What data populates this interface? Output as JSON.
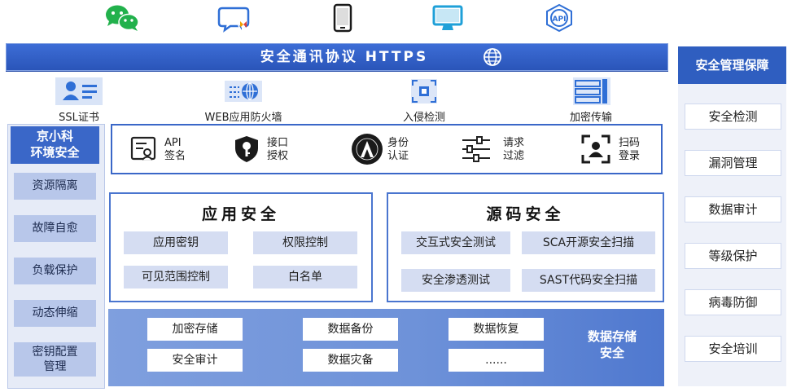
{
  "top_icons": [
    "wechat-icon",
    "chat-icon",
    "mobile-phone-icon",
    "monitor-icon",
    "api-icon"
  ],
  "https_bar": {
    "title": "安全通讯协议 HTTPS",
    "icon": "globe-icon"
  },
  "security_items": [
    {
      "label": "SSL证书",
      "icon": "ssl-certificate-icon"
    },
    {
      "label": "WEB应用防火墙",
      "icon": "web-firewall-icon"
    },
    {
      "label": "入侵检测",
      "icon": "intrusion-detection-icon"
    },
    {
      "label": "加密传输",
      "icon": "encrypted-transfer-icon"
    }
  ],
  "left_column": {
    "title_line1": "京小科",
    "title_line2": "环境安全",
    "items": [
      "资源隔离",
      "故障自愈",
      "负载保护",
      "动态伸缩",
      "密钥配置\n管理"
    ]
  },
  "auth": [
    {
      "line1": "API",
      "line2": "签名",
      "icon": "api-sign-icon"
    },
    {
      "line1": "接口",
      "line2": "授权",
      "icon": "key-shield-icon"
    },
    {
      "line1": "身份",
      "line2": "认证",
      "icon": "oauth-icon"
    },
    {
      "line1": "请求",
      "line2": "过滤",
      "icon": "filter-sliders-icon"
    },
    {
      "line1": "扫码",
      "line2": "登录",
      "icon": "scan-login-icon"
    }
  ],
  "app_security": {
    "title": "应用安全",
    "items": [
      "应用密钥",
      "权限控制",
      "可见范围控制",
      "白名单"
    ]
  },
  "source_security": {
    "title": "源码安全",
    "items": [
      "交互式安全测试",
      "SCA开源安全扫描",
      "安全渗透测试",
      "SAST代码安全扫描"
    ]
  },
  "data_storage": {
    "title_line1": "数据存储",
    "title_line2": "安全",
    "items": [
      "加密存储",
      "数据备份",
      "数据恢复",
      "安全审计",
      "数据灾备",
      "......"
    ]
  },
  "right_column": {
    "title": "安全管理保障",
    "items": [
      "安全检测",
      "漏洞管理",
      "数据审计",
      "等级保护",
      "病毒防御",
      "安全培训"
    ]
  },
  "colors": {
    "primary": "#2f5ec0",
    "light": "#d5ddf2",
    "wechat": "#22b14c"
  }
}
